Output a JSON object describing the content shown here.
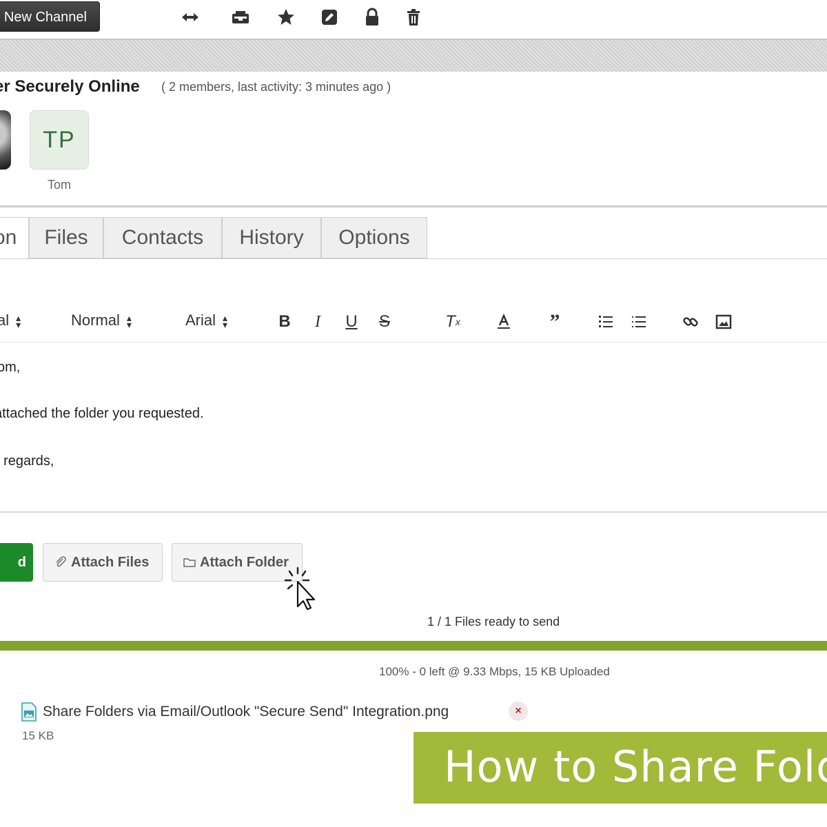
{
  "toolbar": {
    "new_channel_label": "New Channel",
    "icons": [
      "transfer-icon",
      "inbox-icon",
      "star-icon",
      "edit-icon",
      "lock-icon",
      "trash-icon"
    ]
  },
  "channel": {
    "title": "Transfer Securely Online",
    "title_visible": "er Securely Online",
    "meta": "( 2 members, last activity: 3 minutes ago )",
    "members": [
      {
        "initials": "",
        "name": ""
      },
      {
        "initials": "TP",
        "name": "Tom"
      }
    ]
  },
  "tabs": [
    {
      "label": "on",
      "active": true
    },
    {
      "label": "Files",
      "active": false
    },
    {
      "label": "Contacts",
      "active": false
    },
    {
      "label": "History",
      "active": false
    },
    {
      "label": "Options",
      "active": false
    }
  ],
  "editor": {
    "selects": {
      "format": "al",
      "size": "Normal",
      "font": "Arial"
    },
    "body_lines": [
      "om,",
      "attached the folder you requested.",
      "t regards,"
    ]
  },
  "actions": {
    "send_label": "d",
    "attach_files_label": "Attach Files",
    "attach_folder_label": "Attach Folder"
  },
  "upload": {
    "files_ready": "1 / 1 Files ready to send",
    "progress_percent": 100,
    "stats": "100% - 0 left @ 9.33 Mbps, 15 KB Uploaded",
    "file_name": "Share Folders via Email/Outlook \"Secure Send\" Integration.png",
    "file_size": "15 KB",
    "remove_label": "×"
  },
  "banner": {
    "text": "How to Share Folders"
  },
  "colors": {
    "send_green": "#1c8a2a",
    "progress_green": "#8aad2a",
    "banner_green": "#a2b93a",
    "avatar_green": "#3c6e3f"
  }
}
